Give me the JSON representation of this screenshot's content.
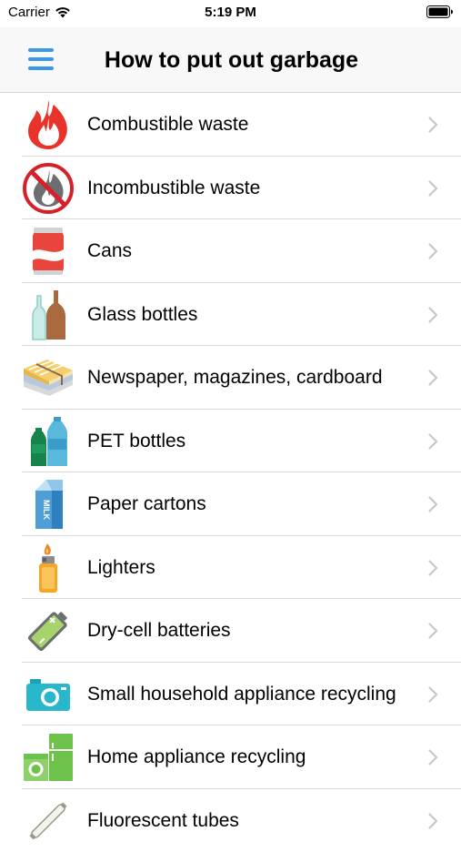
{
  "status": {
    "carrier": "Carrier",
    "time": "5:19 PM"
  },
  "nav": {
    "title": "How to put out garbage",
    "menu_icon": "hamburger-menu-icon"
  },
  "items": [
    {
      "label": "Combustible waste",
      "icon": "flame-icon"
    },
    {
      "label": "Incombustible waste",
      "icon": "no-fire-icon"
    },
    {
      "label": "Cans",
      "icon": "can-icon"
    },
    {
      "label": "Glass bottles",
      "icon": "glass-bottles-icon"
    },
    {
      "label": "Newspaper, magazines, cardboard",
      "icon": "newspaper-bundle-icon"
    },
    {
      "label": "PET bottles",
      "icon": "pet-bottles-icon"
    },
    {
      "label": "Paper cartons",
      "icon": "milk-carton-icon"
    },
    {
      "label": "Lighters",
      "icon": "lighter-icon"
    },
    {
      "label": "Dry-cell batteries",
      "icon": "battery-icon"
    },
    {
      "label": "Small household appliance recycling",
      "icon": "camera-icon"
    },
    {
      "label": "Home appliance recycling",
      "icon": "home-appliances-icon"
    },
    {
      "label": "Fluorescent tubes",
      "icon": "fluorescent-tube-icon"
    }
  ],
  "colors": {
    "accent": "#3b97e8",
    "chevron": "#c7c7cc",
    "separator": "#d9d9dc",
    "nav_background": "#f8f8f8"
  }
}
